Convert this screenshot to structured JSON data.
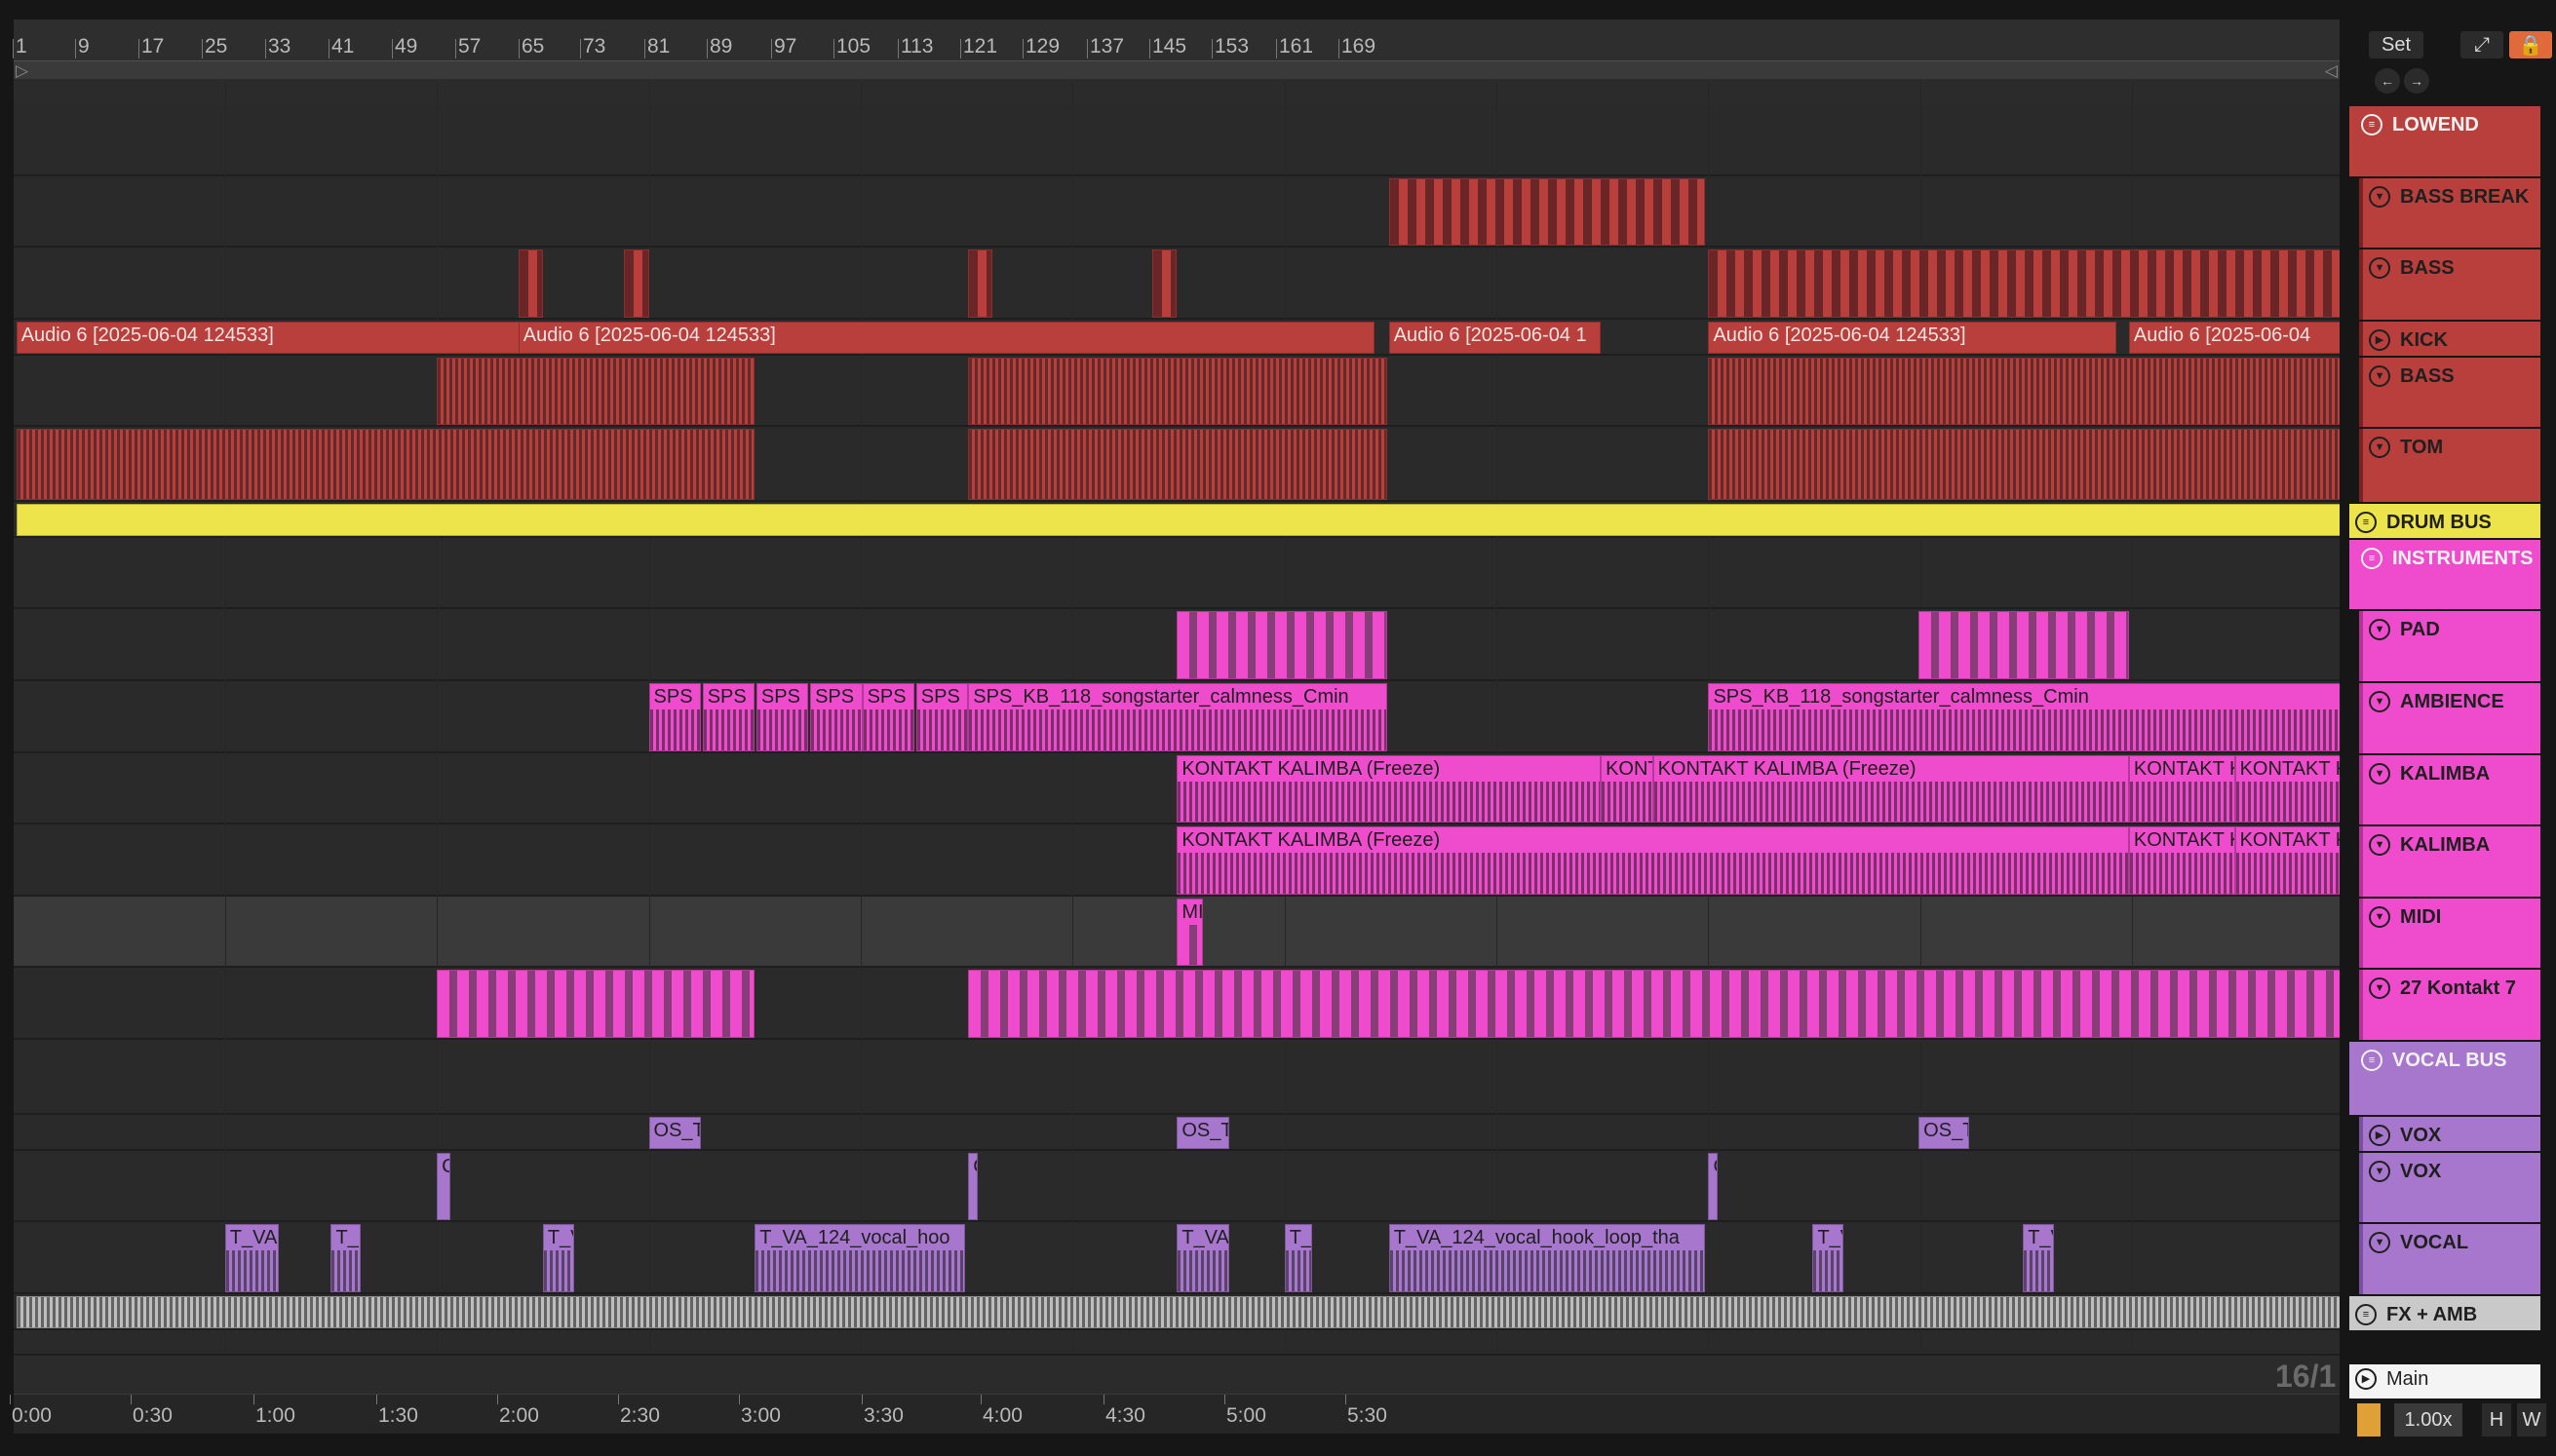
{
  "ruler": {
    "bars": [
      "1",
      "9",
      "17",
      "25",
      "33",
      "41",
      "49",
      "57",
      "65",
      "73",
      "81",
      "89",
      "97",
      "105",
      "113",
      "121",
      "129",
      "137",
      "145",
      "153",
      "161",
      "169"
    ]
  },
  "time_ruler": {
    "labels": [
      "0:00",
      "0:30",
      "1:00",
      "1:30",
      "2:00",
      "2:30",
      "3:00",
      "3:30",
      "4:00",
      "4:30",
      "5:00",
      "5:30"
    ]
  },
  "zoom_readout": "16/1",
  "top_buttons": {
    "set": "Set",
    "expand_icon": "expand-icon",
    "lock_icon": "lock-icon"
  },
  "colors": {
    "red": "#b83f3c",
    "pink": "#ee4ccd",
    "purple": "#a776cd",
    "yellow": "#ece44a",
    "fx": "#c9c9c9"
  },
  "tracks": [
    {
      "name": "LOWEND",
      "type": "group",
      "color": "red"
    },
    {
      "name": "BASS BREAK",
      "type": "midi",
      "color": "red"
    },
    {
      "name": "BASS",
      "type": "midi",
      "color": "red"
    },
    {
      "name": "KICK",
      "type": "audio",
      "color": "red"
    },
    {
      "name": "BASS",
      "type": "midi",
      "color": "red"
    },
    {
      "name": "TOM",
      "type": "midi",
      "color": "red"
    },
    {
      "name": "DRUM BUS",
      "type": "group",
      "color": "yellow"
    },
    {
      "name": "INSTRUMENTS",
      "type": "group",
      "color": "pink"
    },
    {
      "name": "PAD",
      "type": "midi",
      "color": "pink"
    },
    {
      "name": "AMBIENCE",
      "type": "midi",
      "color": "pink"
    },
    {
      "name": "KALIMBA",
      "type": "midi",
      "color": "pink"
    },
    {
      "name": "KALIMBA",
      "type": "midi",
      "color": "pink"
    },
    {
      "name": "MIDI",
      "type": "midi",
      "color": "pink"
    },
    {
      "name": "27 Kontakt 7",
      "type": "midi",
      "color": "pink"
    },
    {
      "name": "VOCAL BUS",
      "type": "group",
      "color": "purple"
    },
    {
      "name": "VOX",
      "type": "audio",
      "color": "purple"
    },
    {
      "name": "VOX",
      "type": "midi",
      "color": "purple"
    },
    {
      "name": "VOCAL",
      "type": "midi",
      "color": "purple"
    },
    {
      "name": "FX + AMB",
      "type": "group",
      "color": "fx"
    },
    {
      "name": "Main",
      "type": "main",
      "color": "white"
    }
  ],
  "clip_names": {
    "audio6": "Audio 6 [2025-06-04 124533]",
    "audio6_short": "Audio 6 [2025-06-04 1",
    "audio6_tail": "Audio 6 [2025-06-04",
    "sps": "SPS",
    "sps_long": "SPS_KB_118_songstarter_calmness_Cmin",
    "kontakt": "KONTAKT KALIMBA (Freeze)",
    "kont_short": "KONT",
    "kontakt_k": "KONTAKT K",
    "kontakt_short2": "KONTAKT K",
    "mi": "MI",
    "os": "OS_T",
    "tva": "T_VA",
    "t": "T_",
    "tv": "T_V",
    "tva_long": "T_VA_124_vocal_hoo",
    "tva_long2": "T_VA_124_vocal_hook_loop_tha",
    "c": "C"
  },
  "bottom_bar": {
    "speed": "1.00x",
    "h": "H",
    "w": "W"
  }
}
